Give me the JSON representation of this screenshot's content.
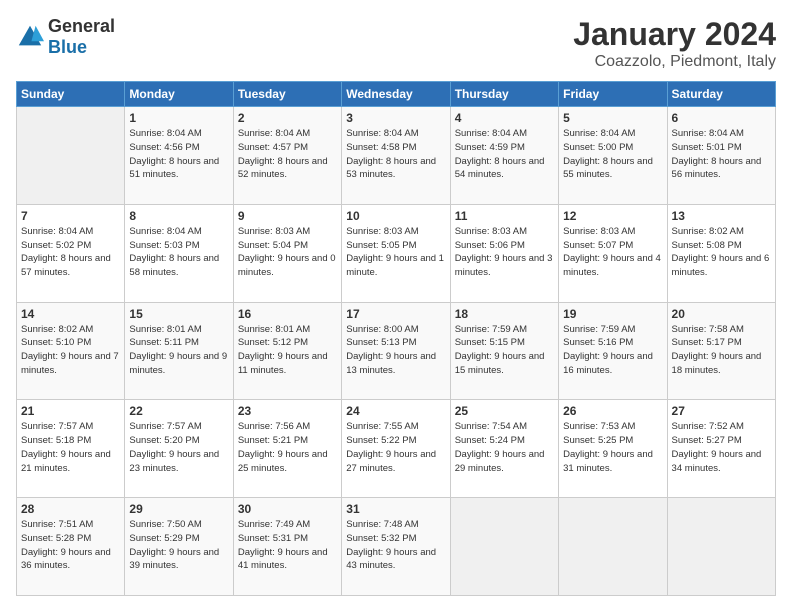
{
  "header": {
    "logo_general": "General",
    "logo_blue": "Blue",
    "title": "January 2024",
    "subtitle": "Coazzolo, Piedmont, Italy"
  },
  "weekdays": [
    "Sunday",
    "Monday",
    "Tuesday",
    "Wednesday",
    "Thursday",
    "Friday",
    "Saturday"
  ],
  "weeks": [
    [
      {
        "day": "",
        "sunrise": "",
        "sunset": "",
        "daylight": ""
      },
      {
        "day": "1",
        "sunrise": "8:04 AM",
        "sunset": "4:56 PM",
        "daylight": "8 hours and 51 minutes."
      },
      {
        "day": "2",
        "sunrise": "8:04 AM",
        "sunset": "4:57 PM",
        "daylight": "8 hours and 52 minutes."
      },
      {
        "day": "3",
        "sunrise": "8:04 AM",
        "sunset": "4:58 PM",
        "daylight": "8 hours and 53 minutes."
      },
      {
        "day": "4",
        "sunrise": "8:04 AM",
        "sunset": "4:59 PM",
        "daylight": "8 hours and 54 minutes."
      },
      {
        "day": "5",
        "sunrise": "8:04 AM",
        "sunset": "5:00 PM",
        "daylight": "8 hours and 55 minutes."
      },
      {
        "day": "6",
        "sunrise": "8:04 AM",
        "sunset": "5:01 PM",
        "daylight": "8 hours and 56 minutes."
      }
    ],
    [
      {
        "day": "7",
        "sunrise": "8:04 AM",
        "sunset": "5:02 PM",
        "daylight": "8 hours and 57 minutes."
      },
      {
        "day": "8",
        "sunrise": "8:04 AM",
        "sunset": "5:03 PM",
        "daylight": "8 hours and 58 minutes."
      },
      {
        "day": "9",
        "sunrise": "8:03 AM",
        "sunset": "5:04 PM",
        "daylight": "9 hours and 0 minutes."
      },
      {
        "day": "10",
        "sunrise": "8:03 AM",
        "sunset": "5:05 PM",
        "daylight": "9 hours and 1 minute."
      },
      {
        "day": "11",
        "sunrise": "8:03 AM",
        "sunset": "5:06 PM",
        "daylight": "9 hours and 3 minutes."
      },
      {
        "day": "12",
        "sunrise": "8:03 AM",
        "sunset": "5:07 PM",
        "daylight": "9 hours and 4 minutes."
      },
      {
        "day": "13",
        "sunrise": "8:02 AM",
        "sunset": "5:08 PM",
        "daylight": "9 hours and 6 minutes."
      }
    ],
    [
      {
        "day": "14",
        "sunrise": "8:02 AM",
        "sunset": "5:10 PM",
        "daylight": "9 hours and 7 minutes."
      },
      {
        "day": "15",
        "sunrise": "8:01 AM",
        "sunset": "5:11 PM",
        "daylight": "9 hours and 9 minutes."
      },
      {
        "day": "16",
        "sunrise": "8:01 AM",
        "sunset": "5:12 PM",
        "daylight": "9 hours and 11 minutes."
      },
      {
        "day": "17",
        "sunrise": "8:00 AM",
        "sunset": "5:13 PM",
        "daylight": "9 hours and 13 minutes."
      },
      {
        "day": "18",
        "sunrise": "7:59 AM",
        "sunset": "5:15 PM",
        "daylight": "9 hours and 15 minutes."
      },
      {
        "day": "19",
        "sunrise": "7:59 AM",
        "sunset": "5:16 PM",
        "daylight": "9 hours and 16 minutes."
      },
      {
        "day": "20",
        "sunrise": "7:58 AM",
        "sunset": "5:17 PM",
        "daylight": "9 hours and 18 minutes."
      }
    ],
    [
      {
        "day": "21",
        "sunrise": "7:57 AM",
        "sunset": "5:18 PM",
        "daylight": "9 hours and 21 minutes."
      },
      {
        "day": "22",
        "sunrise": "7:57 AM",
        "sunset": "5:20 PM",
        "daylight": "9 hours and 23 minutes."
      },
      {
        "day": "23",
        "sunrise": "7:56 AM",
        "sunset": "5:21 PM",
        "daylight": "9 hours and 25 minutes."
      },
      {
        "day": "24",
        "sunrise": "7:55 AM",
        "sunset": "5:22 PM",
        "daylight": "9 hours and 27 minutes."
      },
      {
        "day": "25",
        "sunrise": "7:54 AM",
        "sunset": "5:24 PM",
        "daylight": "9 hours and 29 minutes."
      },
      {
        "day": "26",
        "sunrise": "7:53 AM",
        "sunset": "5:25 PM",
        "daylight": "9 hours and 31 minutes."
      },
      {
        "day": "27",
        "sunrise": "7:52 AM",
        "sunset": "5:27 PM",
        "daylight": "9 hours and 34 minutes."
      }
    ],
    [
      {
        "day": "28",
        "sunrise": "7:51 AM",
        "sunset": "5:28 PM",
        "daylight": "9 hours and 36 minutes."
      },
      {
        "day": "29",
        "sunrise": "7:50 AM",
        "sunset": "5:29 PM",
        "daylight": "9 hours and 39 minutes."
      },
      {
        "day": "30",
        "sunrise": "7:49 AM",
        "sunset": "5:31 PM",
        "daylight": "9 hours and 41 minutes."
      },
      {
        "day": "31",
        "sunrise": "7:48 AM",
        "sunset": "5:32 PM",
        "daylight": "9 hours and 43 minutes."
      },
      {
        "day": "",
        "sunrise": "",
        "sunset": "",
        "daylight": ""
      },
      {
        "day": "",
        "sunrise": "",
        "sunset": "",
        "daylight": ""
      },
      {
        "day": "",
        "sunrise": "",
        "sunset": "",
        "daylight": ""
      }
    ]
  ],
  "labels": {
    "sunrise": "Sunrise:",
    "sunset": "Sunset:",
    "daylight": "Daylight:"
  }
}
